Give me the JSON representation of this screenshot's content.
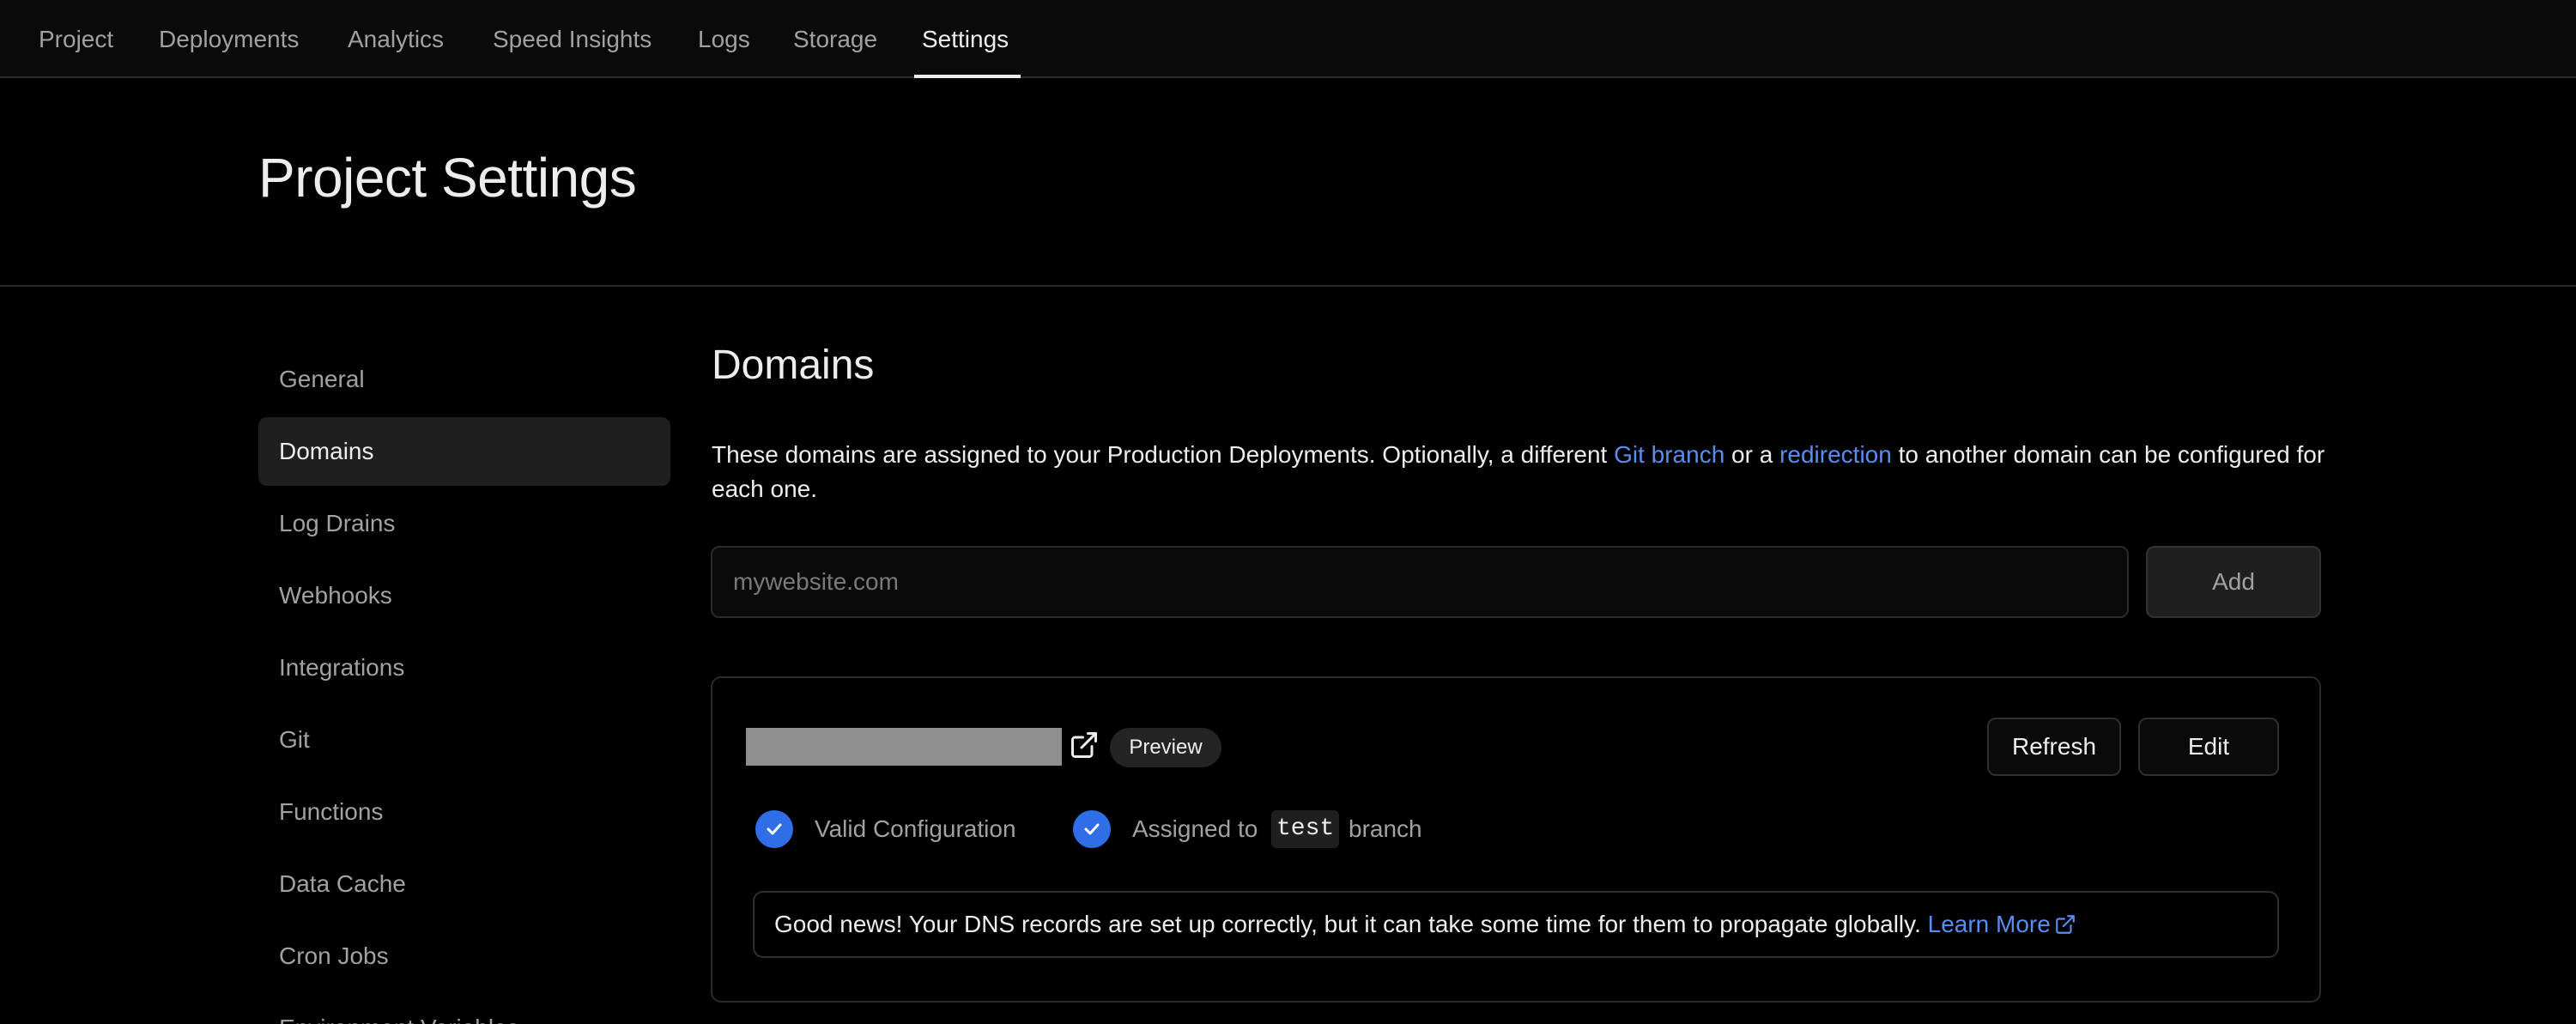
{
  "nav": {
    "tabs": [
      {
        "label": "Project"
      },
      {
        "label": "Deployments"
      },
      {
        "label": "Analytics"
      },
      {
        "label": "Speed Insights"
      },
      {
        "label": "Logs"
      },
      {
        "label": "Storage"
      },
      {
        "label": "Settings",
        "active": true
      }
    ]
  },
  "header": {
    "title": "Project Settings"
  },
  "sidebar": {
    "items": [
      {
        "label": "General"
      },
      {
        "label": "Domains",
        "active": true
      },
      {
        "label": "Log Drains"
      },
      {
        "label": "Webhooks"
      },
      {
        "label": "Integrations"
      },
      {
        "label": "Git"
      },
      {
        "label": "Functions"
      },
      {
        "label": "Data Cache"
      },
      {
        "label": "Cron Jobs"
      },
      {
        "label": "Environment Variables"
      }
    ]
  },
  "domains": {
    "title": "Domains",
    "description": {
      "part1": "These domains are assigned to your Production Deployments. Optionally, a different ",
      "link1": "Git branch",
      "part2": " or a ",
      "link2": "redirection",
      "part3": " to another domain can be configured for each one."
    },
    "input": {
      "placeholder": "mywebsite.com",
      "value": ""
    },
    "add_label": "Add",
    "card": {
      "badge": "Preview",
      "refresh_label": "Refresh",
      "edit_label": "Edit",
      "status_valid": "Valid Configuration",
      "assigned_prefix": "Assigned to",
      "branch_name": "test",
      "assigned_suffix": "branch",
      "notice_text": "Good news! Your DNS records are set up correctly, but it can take some time for them to propagate globally. ",
      "learn_more": "Learn More"
    }
  },
  "colors": {
    "accent": "#2f6ee6",
    "link": "#5b8def",
    "background": "#000000"
  }
}
